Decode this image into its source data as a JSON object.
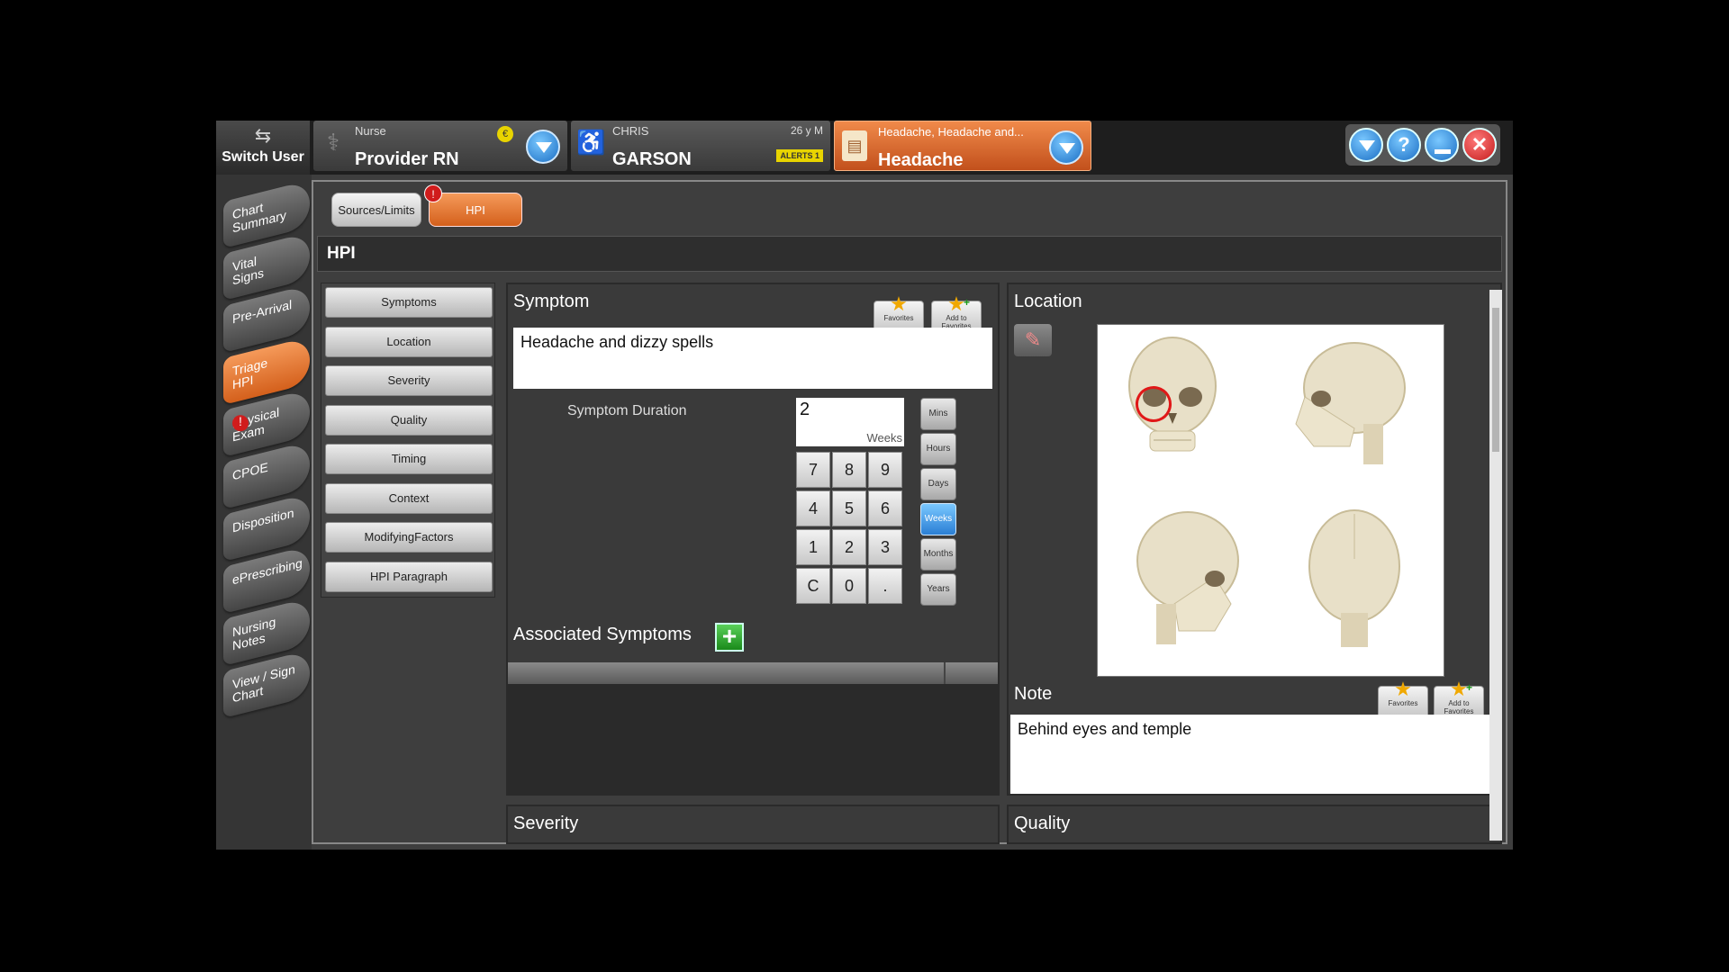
{
  "topbar": {
    "switch_user_label": "Switch User",
    "provider": {
      "role": "Nurse",
      "name": "Provider RN",
      "badge": "€"
    },
    "patient": {
      "first_name": "CHRIS",
      "last_name": "GARSON",
      "age_sex": "26 y M",
      "alerts": "ALERTS 1"
    },
    "complaint": {
      "summary": "Headache, Headache and...",
      "main": "Headache"
    },
    "controls": {
      "help": "?",
      "close": "✕"
    }
  },
  "nav": {
    "items": [
      {
        "label": "Chart\nSummary",
        "badge": ""
      },
      {
        "label": "Vital\nSigns",
        "badge": ""
      },
      {
        "label": "Pre-Arrival",
        "badge": ""
      },
      {
        "label": "Triage\nHPI",
        "badge": ""
      },
      {
        "label": "Physical\nExam",
        "badge": "!"
      },
      {
        "label": "CPOE",
        "badge": ""
      },
      {
        "label": "Disposition",
        "badge": ""
      },
      {
        "label": "ePrescribing",
        "badge": ""
      },
      {
        "label": "Nursing\nNotes",
        "badge": ""
      },
      {
        "label": "View / Sign\nChart",
        "badge": ""
      }
    ]
  },
  "tabs": {
    "sources": "Sources/Limits",
    "hpi": "HPI",
    "hpi_badge": "!"
  },
  "section_title": "HPI",
  "side_buttons": [
    "Symptoms",
    "Location",
    "Severity",
    "Quality",
    "Timing",
    "Context",
    "ModifyingFactors",
    "HPI Paragraph"
  ],
  "symptom": {
    "title": "Symptom",
    "text": "Headache and dizzy spells",
    "favorites": "Favorites",
    "add_favorites": "Add to Favorites",
    "duration_label": "Symptom Duration",
    "duration_value": "2",
    "duration_unit": "Weeks",
    "keys": [
      "7",
      "8",
      "9",
      "4",
      "5",
      "6",
      "1",
      "2",
      "3",
      "C",
      "0",
      "."
    ],
    "units": [
      "Mins",
      "Hours",
      "Days",
      "Weeks",
      "Months",
      "Years"
    ],
    "selected_unit": "Weeks"
  },
  "associated": {
    "title": "Associated Symptoms",
    "add": "+"
  },
  "location": {
    "title": "Location",
    "note_title": "Note",
    "note_text": "Behind eyes and temple",
    "favorites": "Favorites",
    "add_favorites": "Add to Favorites"
  },
  "severity": {
    "title": "Severity"
  },
  "quality": {
    "title": "Quality"
  }
}
